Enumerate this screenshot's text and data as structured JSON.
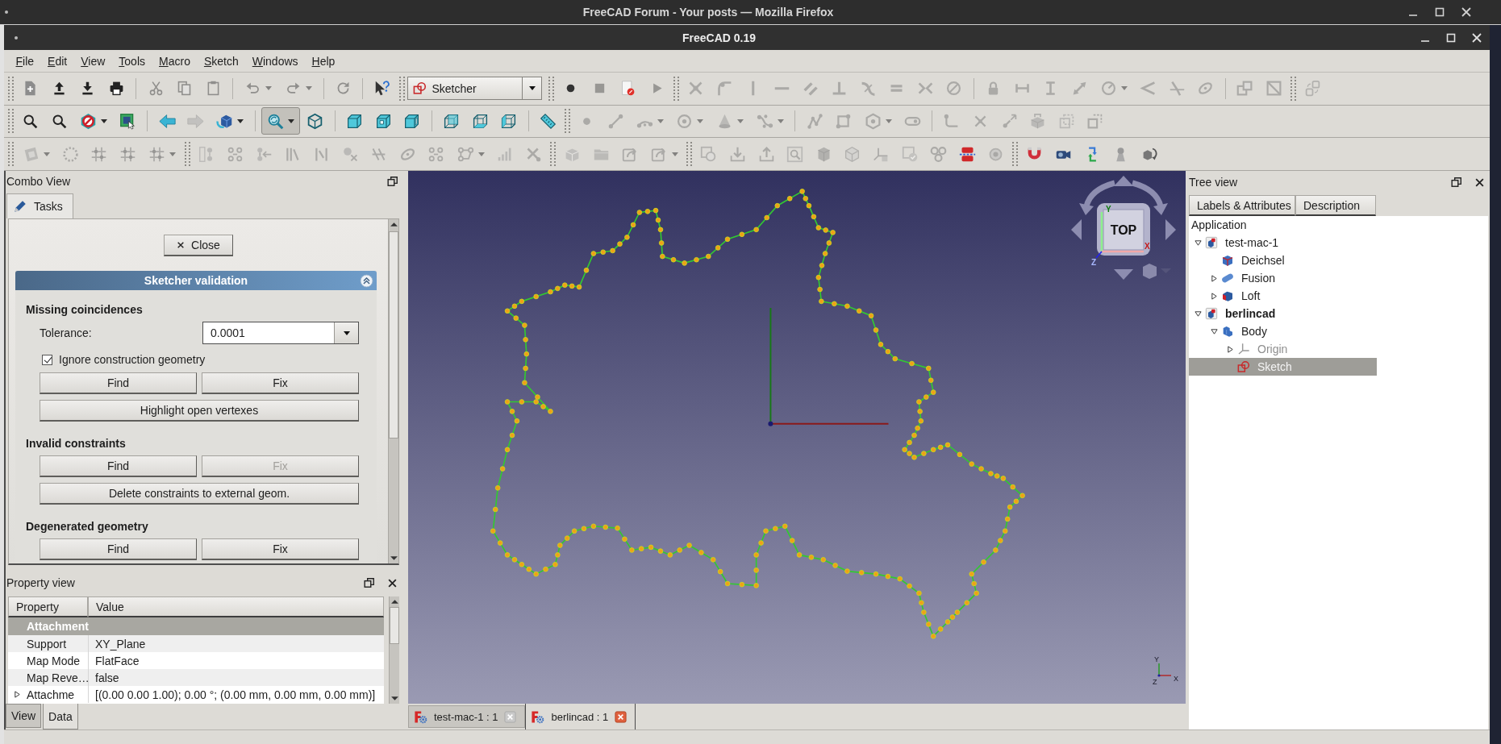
{
  "firefox_window": {
    "title": "FreeCAD Forum - Your posts — Mozilla Firefox"
  },
  "window": {
    "title": "FreeCAD 0.19"
  },
  "menu": [
    "File",
    "Edit",
    "View",
    "Tools",
    "Macro",
    "Sketch",
    "Windows",
    "Help"
  ],
  "toolbars": [
    {
      "items": [
        {
          "kind": "handle"
        },
        {
          "kind": "button",
          "disabled": false,
          "checked": false
        },
        {
          "kind": "button",
          "disabled": false,
          "checked": false
        },
        {
          "kind": "button",
          "disabled": false,
          "checked": false
        },
        {
          "kind": "button",
          "disabled": false,
          "checked": false
        },
        {
          "kind": "separator"
        },
        {
          "kind": "button",
          "disabled": true,
          "checked": false
        },
        {
          "kind": "button",
          "disabled": true,
          "checked": false
        },
        {
          "kind": "button",
          "disabled": true,
          "checked": false
        },
        {
          "kind": "separator"
        },
        {
          "kind": "split",
          "disabled": true,
          "checked": false
        },
        {
          "kind": "split",
          "disabled": true,
          "checked": false
        },
        {
          "kind": "separator"
        },
        {
          "kind": "button",
          "disabled": true,
          "checked": false
        },
        {
          "kind": "separator"
        },
        {
          "kind": "button",
          "disabled": false,
          "checked": false
        },
        {
          "kind": "handle"
        },
        {
          "kind": "combo",
          "value": "Sketcher"
        },
        {
          "kind": "handle"
        },
        {
          "kind": "button",
          "disabled": false,
          "checked": false
        },
        {
          "kind": "button",
          "disabled": true,
          "checked": false
        },
        {
          "kind": "button",
          "disabled": false,
          "checked": false
        },
        {
          "kind": "button",
          "disabled": true,
          "checked": false
        },
        {
          "kind": "handle"
        },
        {
          "kind": "button",
          "disabled": true,
          "checked": false
        },
        {
          "kind": "button",
          "disabled": true,
          "checked": false
        },
        {
          "kind": "button",
          "disabled": true,
          "checked": false
        },
        {
          "kind": "button",
          "disabled": true,
          "checked": false
        },
        {
          "kind": "button",
          "disabled": true,
          "checked": false
        },
        {
          "kind": "button",
          "disabled": true,
          "checked": false
        },
        {
          "kind": "button",
          "disabled": true,
          "checked": false
        },
        {
          "kind": "button",
          "disabled": true,
          "checked": false
        },
        {
          "kind": "button",
          "disabled": true,
          "checked": false
        },
        {
          "kind": "button",
          "disabled": true,
          "checked": false
        },
        {
          "kind": "separator"
        },
        {
          "kind": "button",
          "disabled": true,
          "checked": false
        },
        {
          "kind": "button",
          "disabled": true,
          "checked": false
        },
        {
          "kind": "button",
          "disabled": true,
          "checked": false
        },
        {
          "kind": "button",
          "disabled": true,
          "checked": false
        },
        {
          "kind": "split",
          "disabled": true,
          "checked": false
        },
        {
          "kind": "button",
          "disabled": true,
          "checked": false
        },
        {
          "kind": "button",
          "disabled": true,
          "checked": false
        },
        {
          "kind": "button",
          "disabled": true,
          "checked": false
        },
        {
          "kind": "separator"
        },
        {
          "kind": "button",
          "disabled": true,
          "checked": false
        },
        {
          "kind": "button",
          "disabled": true,
          "checked": false
        },
        {
          "kind": "handle"
        },
        {
          "kind": "button",
          "disabled": true,
          "checked": false
        }
      ]
    },
    {
      "items": [
        {
          "kind": "handle"
        },
        {
          "kind": "button",
          "disabled": false,
          "checked": false
        },
        {
          "kind": "button",
          "disabled": false,
          "checked": false
        },
        {
          "kind": "split",
          "disabled": false,
          "checked": false
        },
        {
          "kind": "button",
          "disabled": false,
          "checked": false
        },
        {
          "kind": "separator"
        },
        {
          "kind": "button",
          "disabled": false,
          "checked": false
        },
        {
          "kind": "button",
          "disabled": true,
          "checked": false
        },
        {
          "kind": "split",
          "disabled": false,
          "checked": false
        },
        {
          "kind": "separator"
        },
        {
          "kind": "split",
          "disabled": false,
          "checked": true
        },
        {
          "kind": "button",
          "disabled": false,
          "checked": false
        },
        {
          "kind": "separator"
        },
        {
          "kind": "button",
          "disabled": false,
          "checked": false
        },
        {
          "kind": "button",
          "disabled": false,
          "checked": false
        },
        {
          "kind": "button",
          "disabled": false,
          "checked": false
        },
        {
          "kind": "separator"
        },
        {
          "kind": "button",
          "disabled": false,
          "checked": false
        },
        {
          "kind": "button",
          "disabled": false,
          "checked": false
        },
        {
          "kind": "button",
          "disabled": false,
          "checked": false
        },
        {
          "kind": "separator"
        },
        {
          "kind": "button",
          "disabled": false,
          "checked": false
        },
        {
          "kind": "handle"
        },
        {
          "kind": "button",
          "disabled": true,
          "checked": false
        },
        {
          "kind": "button",
          "disabled": true,
          "checked": false
        },
        {
          "kind": "split",
          "disabled": true,
          "checked": false
        },
        {
          "kind": "split",
          "disabled": true,
          "checked": false
        },
        {
          "kind": "split",
          "disabled": true,
          "checked": false
        },
        {
          "kind": "split",
          "disabled": true,
          "checked": false
        },
        {
          "kind": "separator"
        },
        {
          "kind": "button",
          "disabled": true,
          "checked": false
        },
        {
          "kind": "button",
          "disabled": true,
          "checked": false
        },
        {
          "kind": "split",
          "disabled": true,
          "checked": false
        },
        {
          "kind": "button",
          "disabled": true,
          "checked": false
        },
        {
          "kind": "separator"
        },
        {
          "kind": "button",
          "disabled": true,
          "checked": false
        },
        {
          "kind": "button",
          "disabled": true,
          "checked": false
        },
        {
          "kind": "button",
          "disabled": true,
          "checked": false
        },
        {
          "kind": "button",
          "disabled": true,
          "checked": false
        },
        {
          "kind": "button",
          "disabled": true,
          "checked": false
        },
        {
          "kind": "button",
          "disabled": true,
          "checked": false
        }
      ]
    },
    {
      "items": [
        {
          "kind": "handle"
        },
        {
          "kind": "split",
          "disabled": true,
          "checked": false
        },
        {
          "kind": "button",
          "disabled": true,
          "checked": false
        },
        {
          "kind": "button",
          "disabled": true,
          "checked": false
        },
        {
          "kind": "button",
          "disabled": true,
          "checked": false
        },
        {
          "kind": "split",
          "disabled": true,
          "checked": false
        },
        {
          "kind": "handle"
        },
        {
          "kind": "button",
          "disabled": true,
          "checked": false
        },
        {
          "kind": "button",
          "disabled": true,
          "checked": false
        },
        {
          "kind": "button",
          "disabled": true,
          "checked": false
        },
        {
          "kind": "button",
          "disabled": true,
          "checked": false
        },
        {
          "kind": "button",
          "disabled": true,
          "checked": false
        },
        {
          "kind": "button",
          "disabled": true,
          "checked": false
        },
        {
          "kind": "button",
          "disabled": true,
          "checked": false
        },
        {
          "kind": "button",
          "disabled": true,
          "checked": false
        },
        {
          "kind": "button",
          "disabled": true,
          "checked": false
        },
        {
          "kind": "split",
          "disabled": true,
          "checked": false
        },
        {
          "kind": "button",
          "disabled": true,
          "checked": false
        },
        {
          "kind": "button",
          "disabled": true,
          "checked": false
        },
        {
          "kind": "handle"
        },
        {
          "kind": "button",
          "disabled": true,
          "checked": false
        },
        {
          "kind": "button",
          "disabled": true,
          "checked": false
        },
        {
          "kind": "button",
          "disabled": true,
          "checked": false
        },
        {
          "kind": "split",
          "disabled": true,
          "checked": false
        },
        {
          "kind": "handle"
        },
        {
          "kind": "button",
          "disabled": true,
          "checked": false
        },
        {
          "kind": "button",
          "disabled": true,
          "checked": false
        },
        {
          "kind": "button",
          "disabled": true,
          "checked": false
        },
        {
          "kind": "button",
          "disabled": true,
          "checked": false
        },
        {
          "kind": "button",
          "disabled": true,
          "checked": false
        },
        {
          "kind": "button",
          "disabled": true,
          "checked": false
        },
        {
          "kind": "button",
          "disabled": true,
          "checked": false
        },
        {
          "kind": "button",
          "disabled": true,
          "checked": false
        },
        {
          "kind": "button",
          "disabled": true,
          "checked": false
        },
        {
          "kind": "button",
          "disabled": false,
          "checked": false
        },
        {
          "kind": "button",
          "disabled": true,
          "checked": false
        },
        {
          "kind": "handle"
        },
        {
          "kind": "button",
          "disabled": false,
          "checked": false
        },
        {
          "kind": "button",
          "disabled": false,
          "checked": false
        },
        {
          "kind": "button",
          "disabled": false,
          "checked": false
        },
        {
          "kind": "button",
          "disabled": false,
          "checked": false
        },
        {
          "kind": "button",
          "disabled": false,
          "checked": false
        }
      ]
    }
  ],
  "combo_view": {
    "title": "Combo View",
    "tabs": [
      {
        "label": "Tasks",
        "selected": true
      }
    ],
    "close_button": "Close",
    "task_box": {
      "title": "Sketcher validation",
      "expanded": true,
      "sections": [
        {
          "title": "Missing coincidences",
          "items": [
            {
              "kind": "field",
              "label": "Tolerance:",
              "value": "0.0001"
            },
            {
              "kind": "checkbox",
              "label": "Ignore construction geometry",
              "checked": true
            },
            {
              "kind": "pair",
              "buttons": [
                {
                  "label": "Find",
                  "disabled": false
                },
                {
                  "label": "Fix",
                  "disabled": false
                }
              ]
            },
            {
              "kind": "button",
              "label": "Highlight open vertexes",
              "disabled": false
            }
          ]
        },
        {
          "title": "Invalid constraints",
          "items": [
            {
              "kind": "pair",
              "buttons": [
                {
                  "label": "Find",
                  "disabled": false
                },
                {
                  "label": "Fix",
                  "disabled": true
                }
              ]
            },
            {
              "kind": "button",
              "label": "Delete constraints to external geom.",
              "disabled": false
            }
          ]
        },
        {
          "title": "Degenerated geometry",
          "items": [
            {
              "kind": "pair",
              "buttons": [
                {
                  "label": "Find",
                  "disabled": false
                },
                {
                  "label": "Fix",
                  "disabled": false
                }
              ]
            }
          ]
        }
      ]
    }
  },
  "property_view": {
    "title": "Property view",
    "columns": [
      "Property",
      "Value"
    ],
    "groups": [
      {
        "name": "Attachment",
        "rows": [
          {
            "property": "Support",
            "value": "XY_Plane"
          },
          {
            "property": "Map Mode",
            "value": "FlatFace"
          },
          {
            "property": "Map Reve…",
            "value": "false"
          },
          {
            "property": "Attachme",
            "value": "[(0.00 0.00 1.00); 0.00 °; (0.00 mm, 0.00 mm, 0.00 mm)]",
            "expanded": false
          }
        ]
      }
    ],
    "tabs": [
      {
        "label": "View",
        "selected": false
      },
      {
        "label": "Data",
        "selected": true
      }
    ]
  },
  "viewport": {
    "navigation_cube": {
      "face": "TOP",
      "axis_labels": [
        "Y",
        "X",
        "Z"
      ]
    },
    "axis_triad": [
      "Y",
      "Z",
      "X"
    ],
    "tabs": [
      {
        "label": "test-mac-1 : 1",
        "selected": false
      },
      {
        "label": "berlincad : 1",
        "selected": true
      }
    ]
  },
  "tree_view": {
    "title": "Tree view",
    "columns": [
      "Labels & Attributes",
      "Description"
    ],
    "root": "Application",
    "items": [
      {
        "label": "test-mac-1",
        "kind": "document",
        "selected": false,
        "hidden": false,
        "active": false,
        "expanded": true,
        "children": [
          {
            "label": "Deichsel",
            "kind": "part",
            "selected": false,
            "hidden": false,
            "active": false
          },
          {
            "label": "Fusion",
            "kind": "fusion",
            "selected": false,
            "hidden": false,
            "active": false,
            "expanded": false
          },
          {
            "label": "Loft",
            "kind": "loft",
            "selected": false,
            "hidden": false,
            "active": false,
            "expanded": false
          }
        ]
      },
      {
        "label": "berlincad",
        "kind": "document",
        "selected": false,
        "hidden": false,
        "active": true,
        "expanded": true,
        "children": [
          {
            "label": "Body",
            "kind": "body",
            "selected": false,
            "hidden": false,
            "active": false,
            "expanded": true,
            "children": [
              {
                "label": "Origin",
                "kind": "origin",
                "selected": false,
                "hidden": true,
                "active": false,
                "expanded": false
              },
              {
                "label": "Sketch",
                "kind": "sketch",
                "selected": true,
                "hidden": false,
                "active": false
              }
            ]
          }
        ]
      }
    ]
  }
}
